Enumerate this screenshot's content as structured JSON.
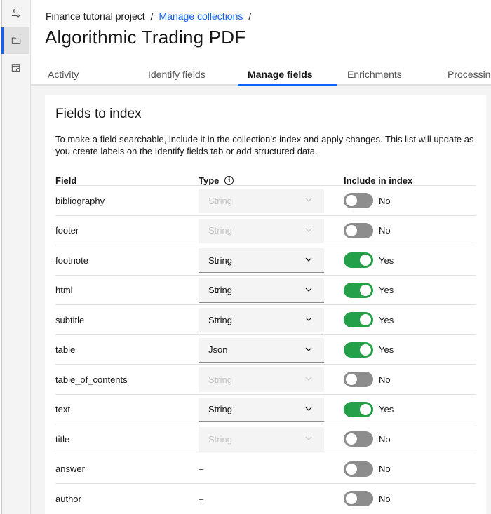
{
  "rail": {
    "items": [
      {
        "icon": "sliders-icon"
      },
      {
        "icon": "folder-icon"
      },
      {
        "icon": "document-settings-icon"
      }
    ]
  },
  "breadcrumb": {
    "project": "Finance tutorial project",
    "collections": "Manage collections",
    "sep1": "/",
    "sep2": "/"
  },
  "page_title": "Algorithmic Trading PDF",
  "tabs": [
    "Activity",
    "Identify fields",
    "Manage fields",
    "Enrichments",
    "Processing"
  ],
  "selected_tab": "Manage fields",
  "card": {
    "title": "Fields to index",
    "description": "To make a field searchable, include it in the collection’s index and apply changes. This list will update as you create labels on the Identify fields tab or add structured data."
  },
  "table": {
    "headers": {
      "field": "Field",
      "type": "Type",
      "include": "Include in index"
    },
    "rows": [
      {
        "field": "bibliography",
        "type": "String",
        "type_enabled": false,
        "include": false,
        "include_label": "No"
      },
      {
        "field": "footer",
        "type": "String",
        "type_enabled": false,
        "include": false,
        "include_label": "No"
      },
      {
        "field": "footnote",
        "type": "String",
        "type_enabled": true,
        "include": true,
        "include_label": "Yes"
      },
      {
        "field": "html",
        "type": "String",
        "type_enabled": true,
        "include": true,
        "include_label": "Yes"
      },
      {
        "field": "subtitle",
        "type": "String",
        "type_enabled": true,
        "include": true,
        "include_label": "Yes"
      },
      {
        "field": "table",
        "type": "Json",
        "type_enabled": true,
        "include": true,
        "include_label": "Yes"
      },
      {
        "field": "table_of_contents",
        "type": "String",
        "type_enabled": false,
        "include": false,
        "include_label": "No"
      },
      {
        "field": "text",
        "type": "String",
        "type_enabled": true,
        "include": true,
        "include_label": "Yes"
      },
      {
        "field": "title",
        "type": "String",
        "type_enabled": false,
        "include": false,
        "include_label": "No"
      },
      {
        "field": "answer",
        "type": "–",
        "type_enabled": null,
        "include": false,
        "include_label": "No"
      },
      {
        "field": "author",
        "type": "–",
        "type_enabled": null,
        "include": false,
        "include_label": "No"
      }
    ]
  },
  "colors": {
    "accent": "#0f62fe",
    "toggle_on": "#24a148",
    "toggle_off": "#8d8d8d"
  }
}
